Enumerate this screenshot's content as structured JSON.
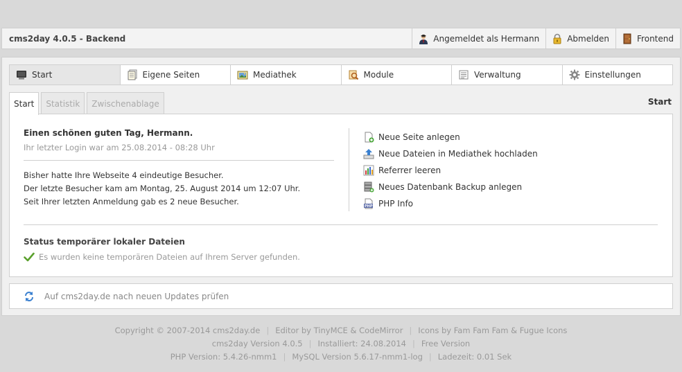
{
  "app": {
    "title": "cms2day 4.0.5 - Backend"
  },
  "topbar": {
    "user_label": "Angemeldet als Hermann",
    "logout_label": "Abmelden",
    "frontend_label": "Frontend"
  },
  "nav": {
    "tabs": [
      {
        "label": "Start",
        "icon": "monitor-icon"
      },
      {
        "label": "Eigene Seiten",
        "icon": "pages-icon"
      },
      {
        "label": "Mediathek",
        "icon": "media-icon"
      },
      {
        "label": "Module",
        "icon": "module-icon"
      },
      {
        "label": "Verwaltung",
        "icon": "admin-icon"
      },
      {
        "label": "Einstellungen",
        "icon": "gear-icon"
      }
    ]
  },
  "subtabs": [
    {
      "label": "Start"
    },
    {
      "label": "Statistik"
    },
    {
      "label": "Zwischenablage"
    }
  ],
  "breadcrumb": "Start",
  "welcome": {
    "greeting": "Einen schönen guten Tag, Hermann.",
    "last_login": "Ihr letzter Login war am 25.08.2014 - 08:28 Uhr",
    "visits": [
      "Bisher hatte Ihre Webseite 4 eindeutige Besucher.",
      "Der letzte Besucher kam am Montag, 25. August 2014 um 12:07 Uhr.",
      "Seit Ihrer letzten Anmeldung gab es 2 neue Besucher."
    ]
  },
  "actions": [
    {
      "label": "Neue Seite anlegen",
      "icon": "page-add-icon"
    },
    {
      "label": "Neue Dateien in Mediathek hochladen",
      "icon": "upload-icon"
    },
    {
      "label": "Referrer leeren",
      "icon": "chart-bar-icon"
    },
    {
      "label": "Neues Datenbank Backup anlegen",
      "icon": "database-add-icon"
    },
    {
      "label": "PHP Info",
      "icon": "php-icon"
    }
  ],
  "status": {
    "title": "Status temporärer lokaler Dateien",
    "message": "Es wurden keine temporären Dateien auf Ihrem Server gefunden."
  },
  "update": {
    "label": "Auf cms2day.de nach neuen Updates prüfen"
  },
  "footer": {
    "line1": [
      "Copyright © 2007-2014 cms2day.de",
      "Editor by TinyMCE & CodeMirror",
      "Icons by Fam Fam Fam & Fugue Icons"
    ],
    "line2": [
      "cms2day Version 4.0.5",
      "Installiert: 24.08.2014",
      "Free Version"
    ],
    "line3": [
      "PHP Version: 5.4.26-nmm1",
      "MySQL Version 5.6.17-nmm1-log",
      "Ladezeit: 0.01 Sek"
    ]
  },
  "colors": {
    "background": "#d9d9d9",
    "border": "#cfcfcf",
    "check": "#5aa02c"
  }
}
